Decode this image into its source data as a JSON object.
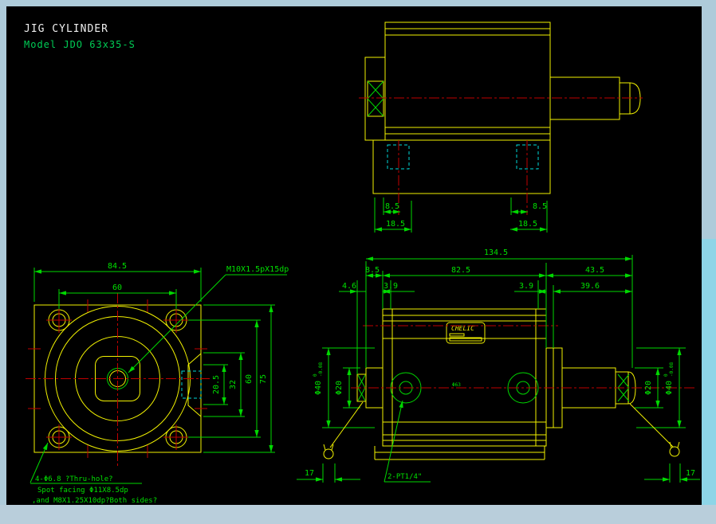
{
  "title": {
    "main": "JIG CYLINDER",
    "model": "Model JDO 63x35-S"
  },
  "logo": {
    "brand": "CHELIC"
  },
  "colors": {
    "line_yellow": "#f2f200",
    "dim_green": "#00d800",
    "center_red": "#c00000",
    "hidden_cyan": "#00d8d8",
    "frame_blue": "#aecbda",
    "scroll_cyan": "#8ed5e7"
  },
  "top_view": {
    "slot_offset_left": "8.5",
    "slot_pos_left": "18.5",
    "slot_offset_right": "8.5",
    "slot_pos_right": "18.5"
  },
  "front_view": {
    "body_width": "84.5",
    "bolt_spacing_h": "60",
    "dim_20_5": "20.5",
    "dim_32": "32",
    "bolt_spacing_v": "60",
    "body_height": "75",
    "thread_leader": "M10X1.5pX15dp",
    "hole_note_1": "4-Φ6.8 ?Thru-hole?",
    "hole_note_2": "Spot facing Φ11X8.5dp",
    "hole_note_3": ",and M8X1.25X10dp?Both sides?"
  },
  "side_view": {
    "overall_length": "134.5",
    "head_len": "8.5",
    "body_len": "82.5",
    "rod_ext_len": "43.5",
    "boss_tip": "4.6",
    "gap_left": "3.9",
    "gap_right": "3.9",
    "rod_len": "39.6",
    "wrench_left": "17",
    "wrench_right": "17",
    "bore": "Φ63",
    "rod_dia": "Φ20",
    "hub_dia": "Φ40",
    "hub_tol_upper": "0",
    "hub_tol_lower": "-0.08",
    "port_leader": "2-PT1/4\""
  }
}
